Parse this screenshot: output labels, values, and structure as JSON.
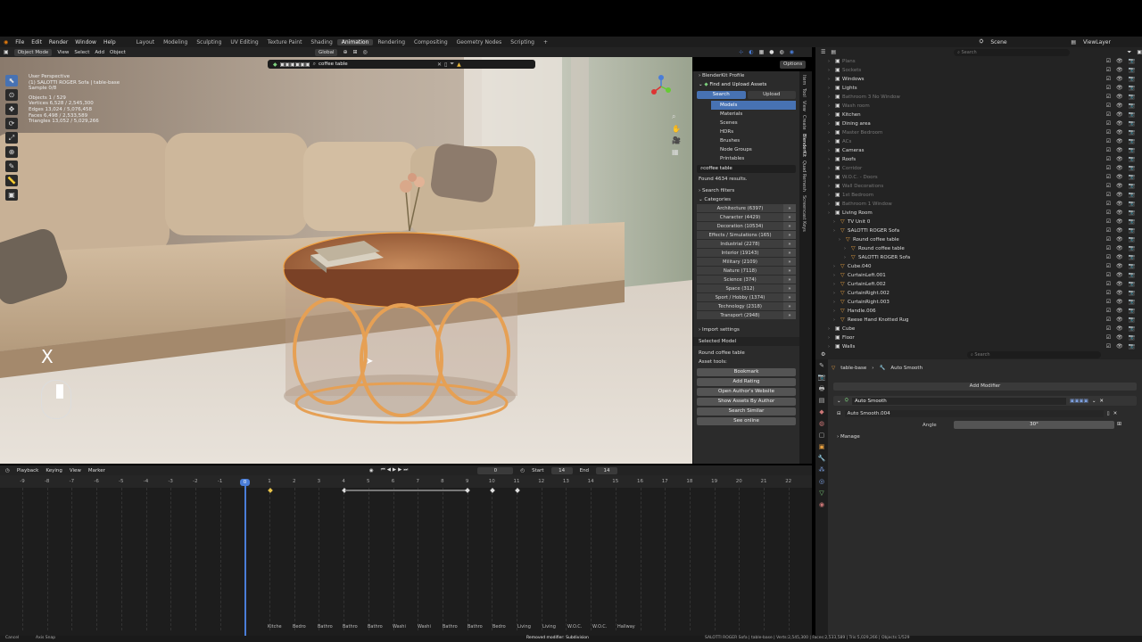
{
  "menu": {
    "items": [
      "File",
      "Edit",
      "Render",
      "Window",
      "Help"
    ],
    "workspaces": [
      "Layout",
      "Modeling",
      "Sculpting",
      "UV Editing",
      "Texture Paint",
      "Shading",
      "Animation",
      "Rendering",
      "Compositing",
      "Geometry Nodes",
      "Scripting"
    ],
    "active_workspace": "Animation",
    "scene": "Scene",
    "view_layer": "ViewLayer"
  },
  "viewport_header": {
    "mode": "Object Mode",
    "view": "View",
    "select": "Select",
    "add": "Add",
    "object": "Object",
    "orientation": "Global",
    "search_value": "coffee table",
    "options": "Options"
  },
  "viewport_info": {
    "perspective": "User Perspective",
    "collection": "(1) SALOTTI ROGER Sofa | table-base",
    "samples": "Sample 0/8",
    "objects": "Objects   1 / 529",
    "vertices": "Vertices   6,528 / 2,545,300",
    "edges": "Edges   13,024 / 5,076,458",
    "faces": "Faces   6,498 / 2,533,589",
    "triangles": "Triangles   13,052 / 5,029,266",
    "overlay_x": "X"
  },
  "npanel": {
    "profile": "BlenderKit Profile",
    "find_upload": "Find and Upload Assets",
    "search_tab": "Search",
    "upload_tab": "Upload",
    "asset_types": [
      "Models",
      "Materials",
      "Scenes",
      "HDRs",
      "Brushes",
      "Node Groups",
      "Printables"
    ],
    "active_type": "Models",
    "query": "coffee table",
    "found": "Found 4634 results.",
    "search_filters": "Search filters",
    "categories_label": "Categories",
    "categories": [
      "Architecture (6397)",
      "Character (4429)",
      "Decoration (10534)",
      "Effects / Simulations (165)",
      "Industrial (2278)",
      "Interior (19143)",
      "Military (2109)",
      "Nature (7118)",
      "Science (374)",
      "Space (312)",
      "Sport / Hobby (1374)",
      "Technology (2318)",
      "Transport (2948)"
    ],
    "import_settings": "Import settings",
    "selected_model": "Selected Model",
    "model_name": "Round coffee table",
    "asset_tools": "Asset tools:",
    "actions": [
      "Bookmark",
      "Add Rating",
      "Open Author's Website",
      "Show Assets By Author",
      "Search Similar",
      "See online"
    ],
    "tabs": [
      "Item",
      "Tool",
      "View",
      "Create",
      "BlenderKit",
      "Quad Remesh",
      "Screencast Keys"
    ]
  },
  "timeline": {
    "header": [
      "Playback",
      "Keying",
      "View",
      "Marker"
    ],
    "current_frame": "0",
    "start_label": "Start",
    "start": "14",
    "end_label": "End",
    "end": "14",
    "ticks": [
      "-9",
      "-8",
      "-7",
      "-6",
      "-5",
      "-4",
      "-3",
      "-2",
      "-1",
      "0",
      "1",
      "2",
      "3",
      "4",
      "5",
      "6",
      "7",
      "8",
      "9",
      "10",
      "11",
      "12",
      "13",
      "14",
      "15",
      "16",
      "17",
      "18",
      "19",
      "20",
      "21",
      "22"
    ],
    "markers": [
      "Kitche",
      "Bedro",
      "Bathro",
      "Bathro",
      "Bathro",
      "Washi",
      "Washi",
      "Bathro",
      "Bathro",
      "Bedro",
      "Living",
      "Living",
      "W.O.C.",
      "W.O.C.",
      "Hallway"
    ]
  },
  "outliner": {
    "search_placeholder": "Search",
    "rows": [
      {
        "label": "Plans",
        "depth": 1,
        "dim": true
      },
      {
        "label": "Sockets",
        "depth": 1,
        "dim": true
      },
      {
        "label": "Windows",
        "depth": 1,
        "dim": false
      },
      {
        "label": "Lights",
        "depth": 1,
        "dim": false
      },
      {
        "label": "Bathroom 3 No Window",
        "depth": 1,
        "dim": true
      },
      {
        "label": "Wash room",
        "depth": 1,
        "dim": true
      },
      {
        "label": "Kitchen",
        "depth": 1,
        "dim": false
      },
      {
        "label": "Dining area",
        "depth": 1,
        "dim": false
      },
      {
        "label": "Master Bedroom",
        "depth": 1,
        "dim": true
      },
      {
        "label": "ACs",
        "depth": 1,
        "dim": true
      },
      {
        "label": "Cameras",
        "depth": 1,
        "dim": false
      },
      {
        "label": "Roofs",
        "depth": 1,
        "dim": false
      },
      {
        "label": "Corridor",
        "depth": 1,
        "dim": true
      },
      {
        "label": "W.O.C. - Doors",
        "depth": 1,
        "dim": true
      },
      {
        "label": "Wall Decorations",
        "depth": 1,
        "dim": true
      },
      {
        "label": "1st Bedroom",
        "depth": 1,
        "dim": true
      },
      {
        "label": "Bathroom 1 Window",
        "depth": 1,
        "dim": true
      },
      {
        "label": "Living Room",
        "depth": 1,
        "dim": false
      },
      {
        "label": "TV Unit 0",
        "depth": 2,
        "dim": false
      },
      {
        "label": "SALOTTI ROGER Sofa",
        "depth": 2,
        "dim": false
      },
      {
        "label": "Round coffee table",
        "depth": 3,
        "dim": false
      },
      {
        "label": "Round coffee table",
        "depth": 4,
        "dim": false
      },
      {
        "label": "SALOTTI ROGER Sofa",
        "depth": 4,
        "dim": false
      },
      {
        "label": "Cube.040",
        "depth": 2,
        "dim": false
      },
      {
        "label": "CurtainLeft.001",
        "depth": 2,
        "dim": false
      },
      {
        "label": "CurtainLeft.002",
        "depth": 2,
        "dim": false
      },
      {
        "label": "CurtainRight.002",
        "depth": 2,
        "dim": false
      },
      {
        "label": "CurtainRight.003",
        "depth": 2,
        "dim": false
      },
      {
        "label": "Handle.006",
        "depth": 2,
        "dim": false
      },
      {
        "label": "Reese Hand Knotted Rug",
        "depth": 2,
        "dim": false
      },
      {
        "label": "Cube",
        "depth": 1,
        "dim": false
      },
      {
        "label": "Floor",
        "depth": 1,
        "dim": false
      },
      {
        "label": "Walls",
        "depth": 1,
        "dim": false
      }
    ]
  },
  "properties": {
    "breadcrumb_object": "table-base",
    "breadcrumb_modifier": "Auto Smooth",
    "search_placeholder": "Search",
    "add_modifier": "Add Modifier",
    "modifier_name": "Auto Smooth",
    "nodegroup": "Auto Smooth.004",
    "angle_label": "Angle",
    "angle_value": "30°",
    "manage": "Manage"
  },
  "status": {
    "left": "Cancel",
    "left2": "Axis Snap",
    "message": "Removed modifier: Subdivision",
    "right": "SALOTTI ROGER Sofa | table-base | Verts:2,545,300 | Faces:2,533,589 | Tris:5,029,266 | Objects:1/529"
  },
  "colors": {
    "accent": "#4772b3",
    "selection_outline": "#f0a040",
    "playhead": "#4a7dd8"
  }
}
